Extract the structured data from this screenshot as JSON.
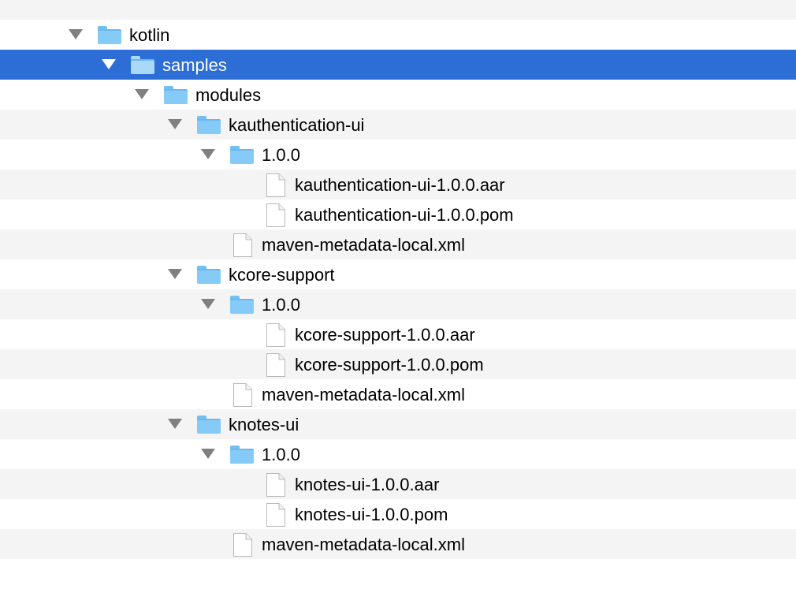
{
  "tree": {
    "rows": [
      {
        "label": "kotlin",
        "type": "folder",
        "expanded": true
      },
      {
        "label": "samples",
        "type": "folder",
        "expanded": true,
        "selected": true
      },
      {
        "label": "modules",
        "type": "folder",
        "expanded": true
      },
      {
        "label": "kauthentication-ui",
        "type": "folder",
        "expanded": true
      },
      {
        "label": "1.0.0",
        "type": "folder",
        "expanded": true
      },
      {
        "label": "kauthentication-ui-1.0.0.aar",
        "type": "file"
      },
      {
        "label": "kauthentication-ui-1.0.0.pom",
        "type": "file"
      },
      {
        "label": "maven-metadata-local.xml",
        "type": "file"
      },
      {
        "label": "kcore-support",
        "type": "folder",
        "expanded": true
      },
      {
        "label": "1.0.0",
        "type": "folder",
        "expanded": true
      },
      {
        "label": "kcore-support-1.0.0.aar",
        "type": "file"
      },
      {
        "label": "kcore-support-1.0.0.pom",
        "type": "file"
      },
      {
        "label": "maven-metadata-local.xml",
        "type": "file"
      },
      {
        "label": "knotes-ui",
        "type": "folder",
        "expanded": true
      },
      {
        "label": "1.0.0",
        "type": "folder",
        "expanded": true
      },
      {
        "label": "knotes-ui-1.0.0.aar",
        "type": "file"
      },
      {
        "label": "knotes-ui-1.0.0.pom",
        "type": "file"
      },
      {
        "label": "maven-metadata-local.xml",
        "type": "file"
      }
    ]
  },
  "colors": {
    "selection": "#2c6dd6",
    "alt_row": "#f4f4f4",
    "folder": "#86cbf8",
    "disclosure": "#808080"
  },
  "icons": {
    "folder": "folder-icon",
    "file": "document-icon",
    "disclosure": "disclosure-triangle-expanded"
  }
}
